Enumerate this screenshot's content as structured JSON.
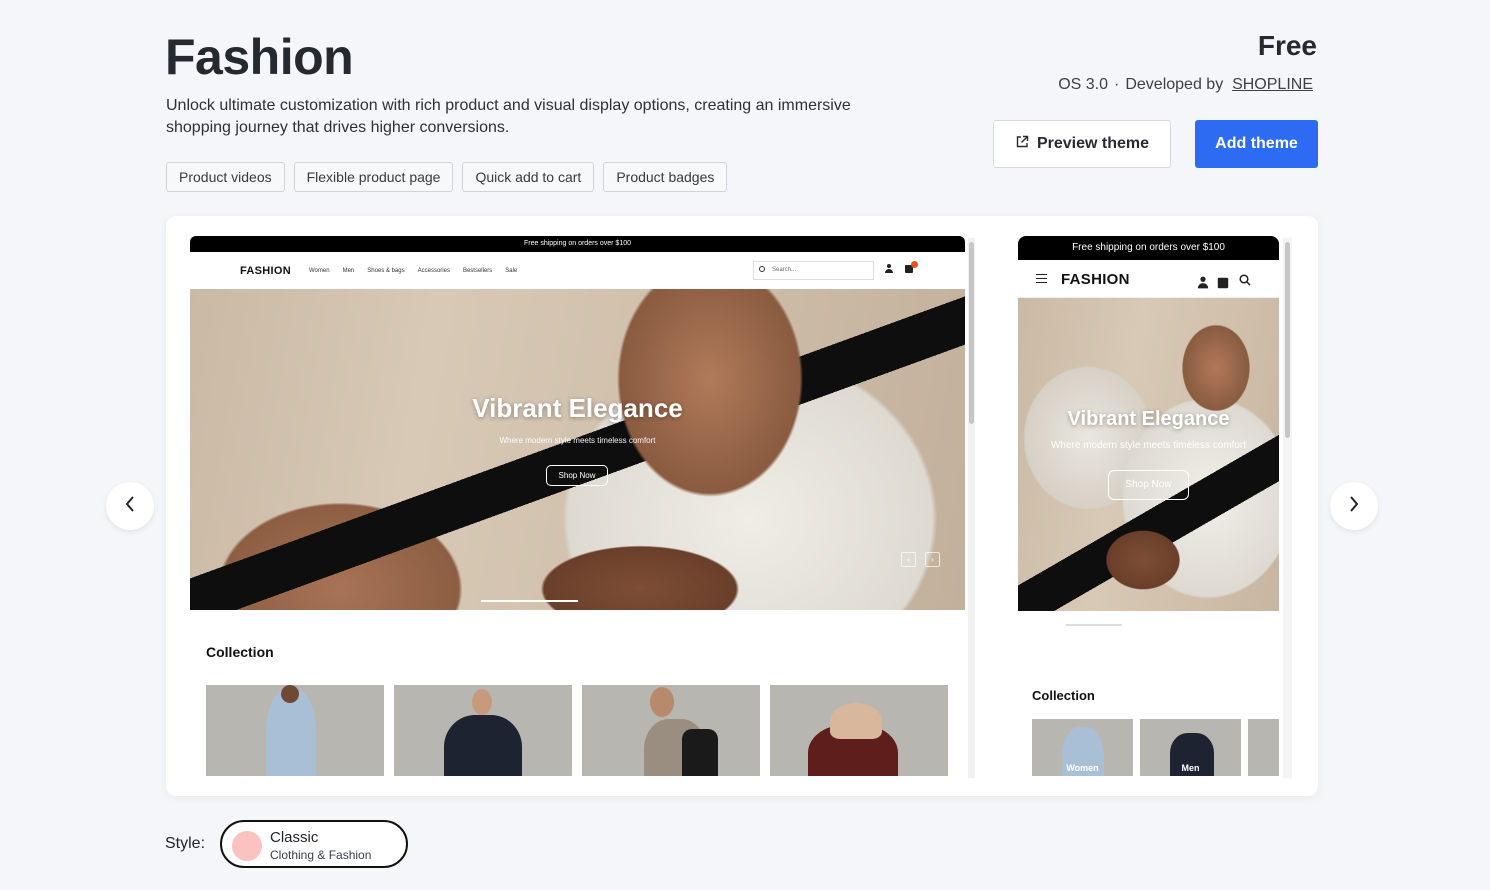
{
  "theme": {
    "title": "Fashion",
    "description": "Unlock ultimate customization with rich product and visual display options, creating an immersive shopping journey that drives higher conversions.",
    "tags": [
      "Product videos",
      "Flexible product page",
      "Quick add to cart",
      "Product badges"
    ],
    "price": "Free",
    "os": "OS 3.0",
    "dot": "·",
    "developed_by": "Developed by",
    "developer": "SHOPLINE",
    "preview_label": "Preview theme",
    "add_label": "Add theme"
  },
  "desktop_preview": {
    "announcement": "Free shipping on orders over $100",
    "logo": "FASHION",
    "menu": [
      "Women",
      "Men",
      "Shoes & bags",
      "Accessories",
      "Bestsellers",
      "Sale"
    ],
    "search_placeholder": "Search...",
    "hero_title": "Vibrant Elegance",
    "hero_subtitle": "Where modern style meets timeless comfort",
    "hero_button": "Shop Now",
    "collection_title": "Collection"
  },
  "mobile_preview": {
    "announcement": "Free shipping on orders over $100",
    "logo": "FASHION",
    "hero_title": "Vibrant Elegance",
    "hero_subtitle": "Where modern style meets timeless comfort",
    "hero_button": "Shop Now",
    "collection_title": "Collection",
    "categories": [
      "Women",
      "Men"
    ]
  },
  "style": {
    "label": "Style:",
    "name": "Classic",
    "category": "Clothing & Fashion",
    "swatch_color": "#fbc2c0"
  },
  "colors": {
    "accent": "#2d6bf2",
    "cart_badge": "#e5541f"
  }
}
